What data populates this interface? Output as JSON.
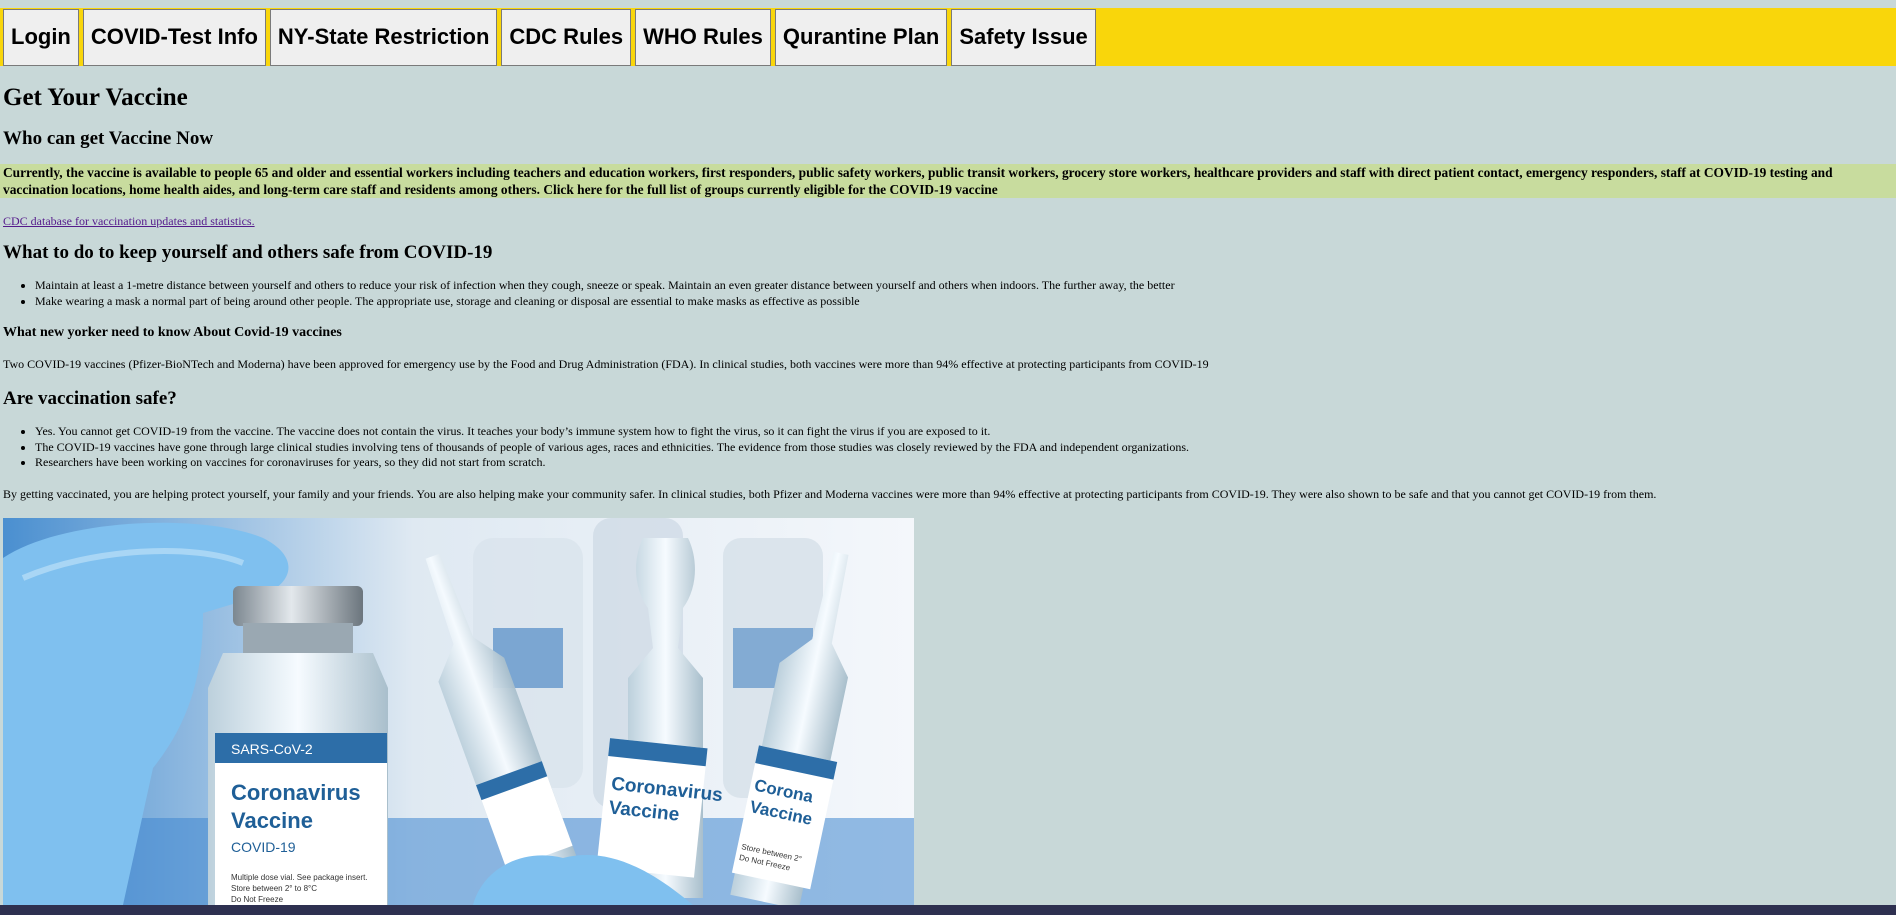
{
  "nav": {
    "buttons": [
      "Login",
      "COVID-Test Info",
      "NY-State Restriction",
      "CDC Rules",
      "WHO Rules",
      "Qurantine Plan",
      "Safety Issue"
    ],
    "bar_color": "#f9d60b"
  },
  "page_title": "Get Your Vaccine",
  "who_heading": "Who can get Vaccine Now",
  "who_text": "Currently, the vaccine is available to people 65 and older and essential workers including teachers and education workers, first responders, public safety workers, public transit workers, grocery store workers, healthcare providers and staff with direct patient contact, emergency responders, staff at COVID-19 testing and vaccination locations, home health aides, and long-term care staff and residents among others. Click here for the full list of groups currently eligible for the COVID-19 vaccine",
  "cdc_link": "CDC database for vaccination updates and statistics.",
  "safe_heading": "What to do to keep yourself and others safe from COVID-19",
  "safe_items": [
    "Maintain at least a 1-metre distance between yourself and others to reduce your risk of infection when they cough, sneeze or speak. Maintain an even greater distance between yourself and others when indoors. The further away, the better",
    "Make wearing a mask a normal part of being around other people. The appropriate use, storage and cleaning or disposal are essential to make masks as effective as possible"
  ],
  "ny_heading": "What new yorker need to know About Covid-19 vaccines",
  "ny_text": "Two COVID-19 vaccines (Pfizer-BioNTech and Moderna) have been approved for emergency use by the Food and Drug Administration (FDA). In clinical studies, both vaccines were more than 94% effective at protecting participants from COVID-19",
  "vax_heading": "Are vaccination safe?",
  "vax_items": [
    "Yes. You cannot get COVID-19 from the vaccine. The vaccine does not contain the virus. It teaches your body’s immune system how to fight the virus, so it can fight the virus if you are exposed to it.",
    "The COVID-19 vaccines have gone through large clinical studies involving tens of thousands of people of various ages, races and ethnicities. The evidence from those studies was closely reviewed by the FDA and independent organizations.",
    "Researchers have been working on vaccines for coronaviruses for years, so they did not start from scratch."
  ],
  "closing_text": "By getting vaccinated, you are helping protect yourself, your family and your friends. You are also helping make your community safer. In clinical studies, both Pfizer and Moderna vaccines were more than 94% effective at protecting participants from COVID-19. They were also shown to be safe and that you cannot get COVID-19 from them.",
  "image": {
    "vial_label_top": "SARS-CoV-2",
    "vial_title_1": "Coronavirus",
    "vial_title_2": "Vaccine",
    "vial_sub": "COVID-19",
    "vial_small_1": "Multiple dose vial. See package insert.",
    "vial_small_2": "Store between 2° to 8°C",
    "vial_small_3": "Do Not Freeze",
    "amp_title_1": "Coronavirus",
    "amp_title_2": "Vaccine",
    "amp2_title_1": "Corona",
    "amp2_title_2": "Vaccine",
    "amp2_small": "Store between 2°",
    "amp2_small_2": "Do Not Freeze"
  }
}
